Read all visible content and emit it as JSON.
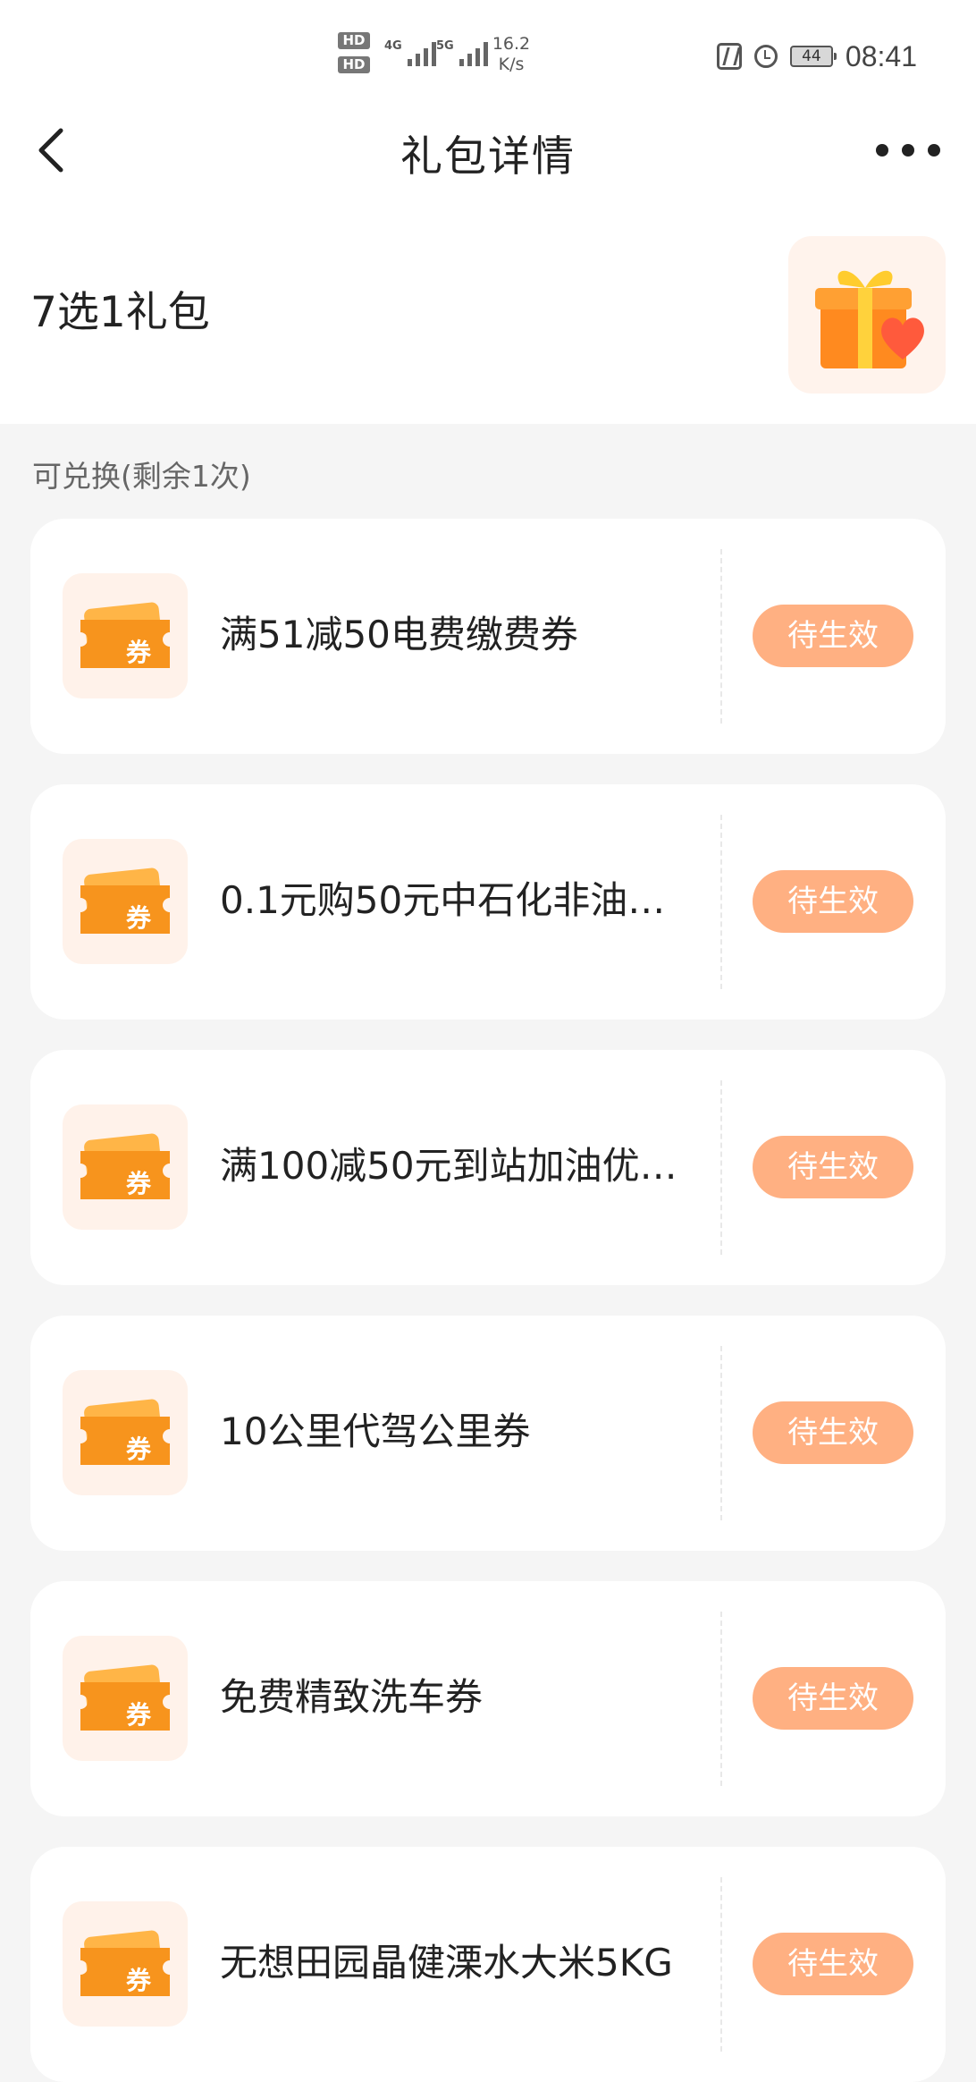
{
  "status_bar": {
    "hd1": "HD",
    "hd2": "HD",
    "net1": "4G",
    "net2": "5G",
    "speed_value": "16.2",
    "speed_unit": "K/s",
    "battery": "44",
    "time": "08:41"
  },
  "header": {
    "title": "礼包详情"
  },
  "gift": {
    "title": "7选1礼包"
  },
  "section_label": "可兑换(剩余1次)",
  "coupon_icon_text": "券",
  "coupons": [
    {
      "name": "满51减50电费缴费券",
      "status": "待生效"
    },
    {
      "name": "0.1元购50元中石化非油…",
      "status": "待生效"
    },
    {
      "name": "满100减50元到站加油优…",
      "status": "待生效"
    },
    {
      "name": "10公里代驾公里券",
      "status": "待生效"
    },
    {
      "name": "免费精致洗车券",
      "status": "待生效"
    },
    {
      "name": "无想田园晶健溧水大米5KG",
      "status": "待生效"
    }
  ],
  "colors": {
    "accent": "#ffb082",
    "coupon_icon": "#f7941d",
    "page_bg": "#f5f5f5"
  },
  "icons": {
    "back": "chevron-left-icon",
    "more": "more-dots-icon",
    "gift": "gift-box-icon",
    "coupon": "ticket-icon"
  }
}
